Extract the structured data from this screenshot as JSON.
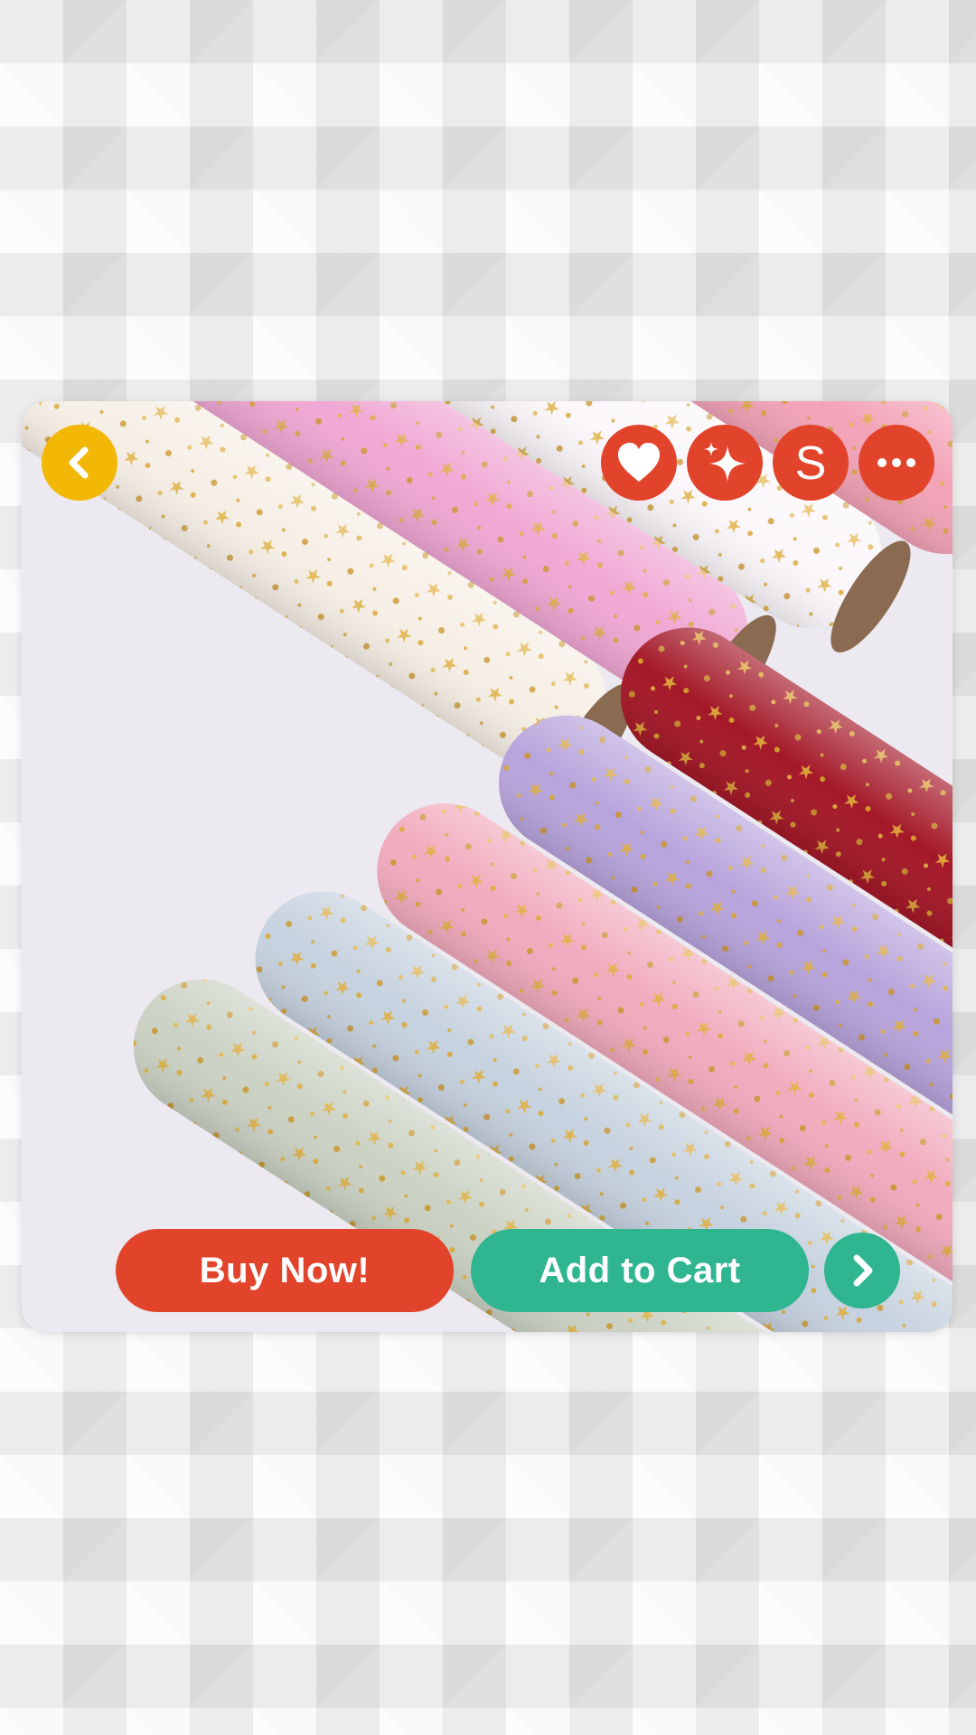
{
  "product": {
    "image": "Rolls of tulle fabric in pink, white, beige, burgundy, lavender, light blue and sage green with gold star and moon sequins"
  },
  "actions": {
    "buy_label": "Buy Now!",
    "cart_label": "Add to Cart",
    "shop_letter": "S"
  },
  "colors": {
    "back": "#f3b705",
    "action": "#e2442b",
    "cart": "#2fb58f"
  },
  "icons": [
    "chevron-left-icon",
    "heart-icon",
    "sparkle-icon",
    "shop-icon",
    "more-icon",
    "chevron-right-icon"
  ]
}
